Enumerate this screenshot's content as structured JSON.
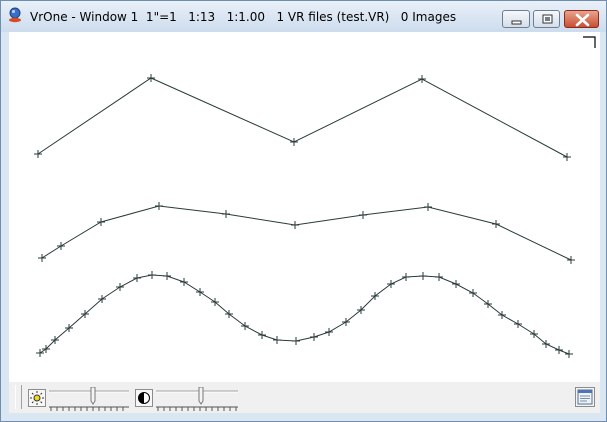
{
  "window": {
    "title": "VrOne - Window 1  1\"=1   1:13   1:1.00   1 VR files (test.VR)   0 Images",
    "title_icon": "vrone-app-icon",
    "controls": [
      "minimize-icon",
      "maximize-icon",
      "close-icon"
    ]
  },
  "canvas": {
    "corner_marker": "corner-bracket-icon",
    "line_color": "#2a3a3a"
  },
  "toolbar": {
    "brightness_icon": "sun-icon",
    "contrast_icon": "contrast-icon",
    "right_button_icon": "window-list-icon"
  }
}
